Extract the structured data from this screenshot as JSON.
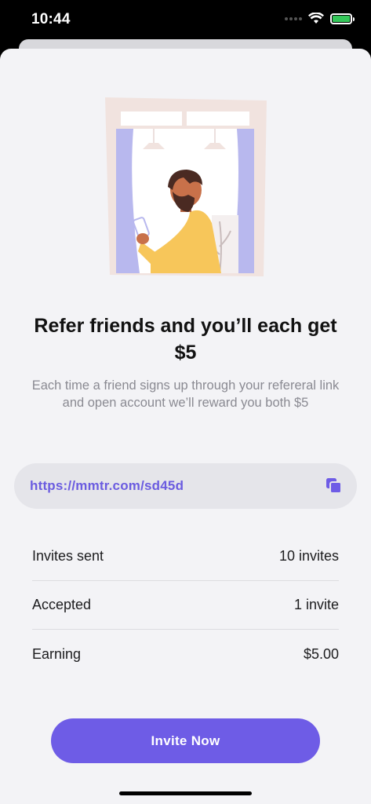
{
  "status_bar": {
    "time": "10:44"
  },
  "referral": {
    "title": "Refer friends and you’ll each get $5",
    "subtitle": "Each time a friend signs up through your refereral link and open account we’ll reward you both $5",
    "link": "https://mmtr.com/sd45d"
  },
  "stats": [
    {
      "label": "Invites sent",
      "value": "10 invites"
    },
    {
      "label": "Accepted",
      "value": "1 invite"
    },
    {
      "label": "Earning",
      "value": "$5.00"
    }
  ],
  "actions": {
    "invite_label": "Invite Now"
  },
  "colors": {
    "accent": "#6e5ce6",
    "link": "#6b5ce0",
    "background": "#f3f3f6"
  }
}
